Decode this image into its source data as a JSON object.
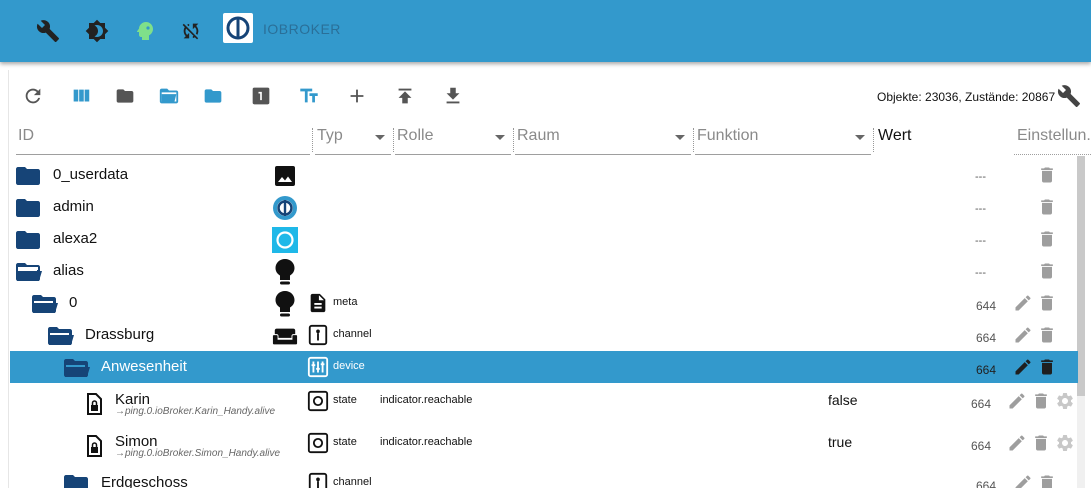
{
  "appbar": {
    "title": "IOBROKER",
    "icons": [
      "wrench-icon",
      "brightness-icon",
      "expert-mode-icon",
      "sync-disabled-icon",
      "iobroker-logo"
    ]
  },
  "toolbar": {
    "icons": [
      "refresh-icon",
      "columns-icon",
      "folder-icon",
      "folder-open-icon",
      "folder-icon",
      "one-box-icon",
      "text-format-icon",
      "plus-icon",
      "upload-icon",
      "download-icon",
      "wrench-icon"
    ],
    "stats": "Objekte: 23036, Zustände: 20867"
  },
  "headers": {
    "id": "ID",
    "type": "Typ",
    "role": "Rolle",
    "room": "Raum",
    "function": "Funktion",
    "value": "Wert",
    "settings": "Einstellun..."
  },
  "rows": [
    {
      "name": "0_userdata",
      "acl": "---",
      "folder": "closed"
    },
    {
      "name": "admin",
      "acl": "---",
      "folder": "closed"
    },
    {
      "name": "alexa2",
      "acl": "---",
      "folder": "closed"
    },
    {
      "name": "alias",
      "acl": "---",
      "folder": "open"
    },
    {
      "name": "0",
      "type": "meta",
      "acl": "644",
      "folder": "open"
    },
    {
      "name": "Drassburg",
      "type": "channel",
      "acl": "664",
      "folder": "open"
    },
    {
      "name": "Anwesenheit",
      "type": "device",
      "acl": "664",
      "folder": "open",
      "selected": true
    },
    {
      "name": "Karin",
      "alias": "→ping.0.ioBroker.Karin_Handy.alive",
      "type": "state",
      "role": "indicator.reachable",
      "value": "false",
      "acl": "664"
    },
    {
      "name": "Simon",
      "alias": "→ping.0.ioBroker.Simon_Handy.alive",
      "type": "state",
      "role": "indicator.reachable",
      "value": "true",
      "acl": "664"
    },
    {
      "name": "Erdgeschoss",
      "type": "channel",
      "acl": "664",
      "folder": "closed"
    }
  ],
  "colors": {
    "accent": "#3399cc",
    "folder": "#164477",
    "iconDark": "#333333",
    "trash": "#9e9e9e"
  }
}
